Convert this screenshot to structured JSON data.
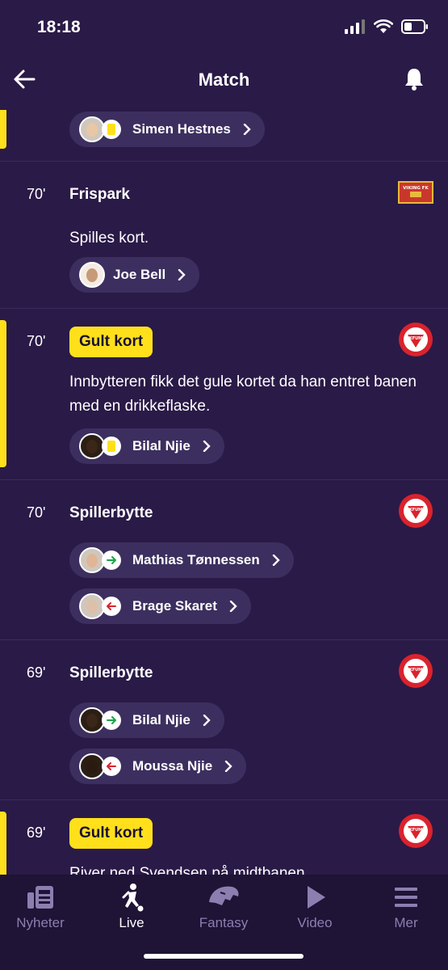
{
  "status": {
    "time": "18:18"
  },
  "header": {
    "title": "Match"
  },
  "events": [
    {
      "player": "Simen Hestnes"
    },
    {
      "minute": "70'",
      "title": "Frispark",
      "description": "Spilles kort.",
      "player": "Joe Bell",
      "team": "VIKING FK"
    },
    {
      "minute": "70'",
      "title": "Gult kort",
      "description": "Innbytteren fikk det gule kortet da han entret banen med en drikkeflaske.",
      "player": "Bilal Njie",
      "team": "KFUM"
    },
    {
      "minute": "70'",
      "title": "Spillerbytte",
      "player_in": "Mathias Tønnessen",
      "player_out": "Brage Skaret",
      "team": "KFUM"
    },
    {
      "minute": "69'",
      "title": "Spillerbytte",
      "player_in": "Bilal Njie",
      "player_out": "Moussa Njie",
      "team": "KFUM"
    },
    {
      "minute": "69'",
      "title": "Gult kort",
      "description": "River ned Svendsen på midtbanen.",
      "team": "KFUM"
    }
  ],
  "tabs": [
    {
      "label": "Nyheter",
      "icon": "news-icon"
    },
    {
      "label": "Live",
      "icon": "football-player-icon",
      "active": true
    },
    {
      "label": "Fantasy",
      "icon": "panther-icon"
    },
    {
      "label": "Video",
      "icon": "play-icon"
    },
    {
      "label": "Mer",
      "icon": "menu-icon"
    }
  ],
  "colors": {
    "background": "#2a1a47",
    "pill": "#3c2f5f",
    "yellow": "#ffe01b",
    "tabbar": "#1f1336",
    "inactive_tab": "#8d7eb0",
    "in_arrow": "#1aa34a",
    "out_arrow": "#d9232d"
  }
}
